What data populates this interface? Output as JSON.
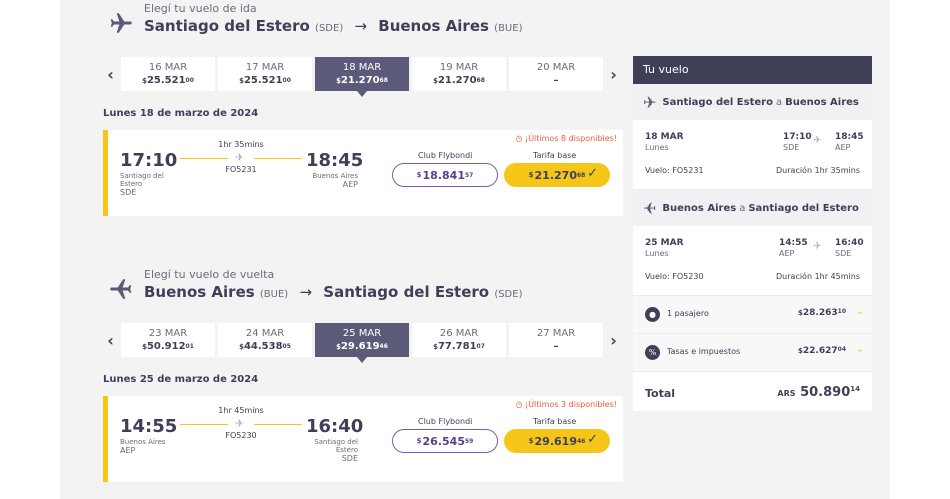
{
  "outbound": {
    "subtitle": "Elegí tu vuelo de ida",
    "origin": "Santiago del Estero",
    "origin_code": "(SDE)",
    "destination": "Buenos Aires",
    "destination_code": "(BUE)",
    "arrow": "→",
    "dates": [
      {
        "date": "16 MAR",
        "cur": "$",
        "int": "25.521",
        "dec": "00"
      },
      {
        "date": "17 MAR",
        "cur": "$",
        "int": "25.521",
        "dec": "00"
      },
      {
        "date": "18 MAR",
        "cur": "$",
        "int": "21.270",
        "dec": "68"
      },
      {
        "date": "19 MAR",
        "cur": "$",
        "int": "21.270",
        "dec": "68"
      },
      {
        "date": "20 MAR",
        "cur": "",
        "int": "–",
        "dec": ""
      }
    ],
    "day_title": "Lunes 18 de marzo de 2024",
    "flight": {
      "dep_time": "17:10",
      "dep_city": "Santiago del Estero",
      "dep_code": "SDE",
      "duration": "1hr 35mins",
      "flight_no": "FO5231",
      "arr_time": "18:45",
      "arr_city": "Buenos Aires",
      "arr_code": "AEP",
      "warning": "¡Últimos 8 disponibles!",
      "club_label": "Club Flybondi",
      "club_cur": "$",
      "club_int": "18.841",
      "club_dec": "57",
      "base_label": "Tarifa base",
      "base_cur": "$",
      "base_int": "21.270",
      "base_dec": "68"
    }
  },
  "return": {
    "subtitle": "Elegí tu vuelo de vuelta",
    "origin": "Buenos Aires",
    "origin_code": "(BUE)",
    "destination": "Santiago del Estero",
    "destination_code": "(SDE)",
    "arrow": "→",
    "dates": [
      {
        "date": "23 MAR",
        "cur": "$",
        "int": "50.912",
        "dec": "01"
      },
      {
        "date": "24 MAR",
        "cur": "$",
        "int": "44.538",
        "dec": "05"
      },
      {
        "date": "25 MAR",
        "cur": "$",
        "int": "29.619",
        "dec": "46"
      },
      {
        "date": "26 MAR",
        "cur": "$",
        "int": "77.781",
        "dec": "07"
      },
      {
        "date": "27 MAR",
        "cur": "",
        "int": "–",
        "dec": ""
      }
    ],
    "day_title": "Lunes 25 de marzo de 2024",
    "flight": {
      "dep_time": "14:55",
      "dep_city": "Buenos Aires",
      "dep_code": "AEP",
      "duration": "1hr 45mins",
      "flight_no": "FO5230",
      "arr_time": "16:40",
      "arr_city": "Santiago del Estero",
      "arr_code": "SDE",
      "warning": "¡Últimos 3 disponibles!",
      "club_label": "Club Flybondi",
      "club_cur": "$",
      "club_int": "26.545",
      "club_dec": "59",
      "base_label": "Tarifa base",
      "base_cur": "$",
      "base_int": "29.619",
      "base_dec": "46"
    }
  },
  "nav": {
    "prev": "‹",
    "next": "›"
  },
  "summary": {
    "title": "Tu vuelo",
    "connector": "a",
    "seg1": {
      "from": "Santiago del Estero",
      "to": "Buenos Aires",
      "date": "18 MAR",
      "dow": "Lunes",
      "dep_time": "17:10",
      "dep_code": "SDE",
      "arr_time": "18:45",
      "arr_code": "AEP",
      "flight": "Vuelo: FO5231",
      "duration": "Duración 1hr 35mins"
    },
    "seg2": {
      "from": "Buenos Aires",
      "to": "Santiago del Estero",
      "date": "25 MAR",
      "dow": "Lunes",
      "dep_time": "14:55",
      "dep_code": "AEP",
      "arr_time": "16:40",
      "arr_code": "SDE",
      "flight": "Vuelo: FO5230",
      "duration": "Duración 1hr 45mins"
    },
    "passengers": {
      "label": "1 pasajero",
      "cur": "$",
      "int": "28.263",
      "dec": "10"
    },
    "taxes": {
      "label": "Tasas e impuestos",
      "cur": "$",
      "int": "22.627",
      "dec": "04"
    },
    "total": {
      "label": "Total",
      "cur": "ARS",
      "int": "50.890",
      "dec": "14"
    }
  },
  "colors": {
    "accent": "#f5c518",
    "primary": "#3f3f58",
    "club": "#7a5fa8",
    "warning": "#e85b3d"
  }
}
